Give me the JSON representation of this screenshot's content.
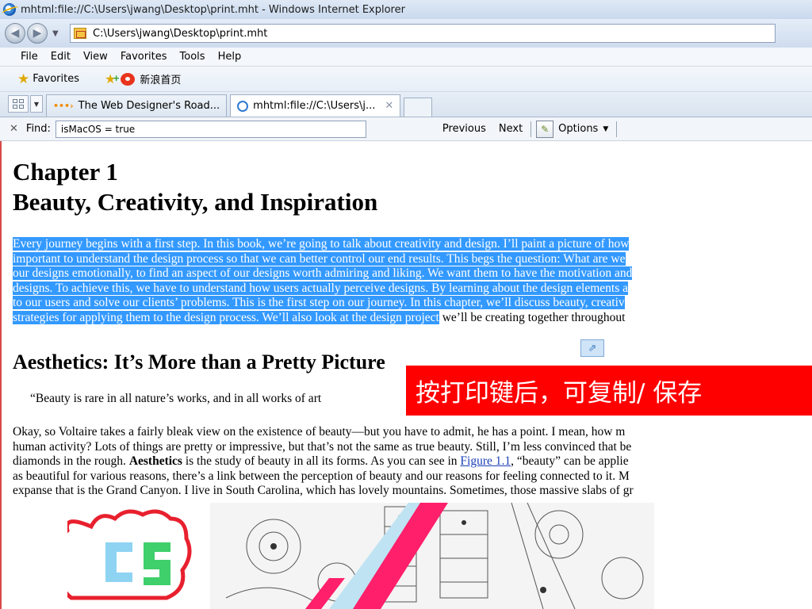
{
  "window": {
    "title": "mhtml:file://C:\\Users\\jwang\\Desktop\\print.mht - Windows Internet Explorer"
  },
  "address_bar": {
    "value": "C:\\Users\\jwang\\Desktop\\print.mht"
  },
  "menu": [
    "File",
    "Edit",
    "View",
    "Favorites",
    "Tools",
    "Help"
  ],
  "favorites_bar": {
    "favorites_label": "Favorites",
    "link_label": "新浪首页"
  },
  "tabs": [
    {
      "label": "The Web Designer's Road...",
      "icon": "rss-icon",
      "active": false
    },
    {
      "label": "mhtml:file://C:\\Users\\j...",
      "icon": "ie-icon",
      "active": true
    }
  ],
  "find_bar": {
    "label": "Find:",
    "value": "isMacOS = true",
    "previous": "Previous",
    "next": "Next",
    "options": "Options"
  },
  "content": {
    "chapter_line1": "Chapter 1",
    "chapter_line2": "Beauty, Creativity, and Inspiration",
    "intro_lines": [
      "Every journey begins with a first step. In this book, we’re going to talk about creativity and design. I’ll paint a picture of how",
      "important to understand the design process so that we can better control our end results. This begs the question: What are we",
      "our designs emotionally, to find an aspect of our designs worth admiring and liking. We want them to have the motivation and",
      "designs. To achieve this, we have to understand how users actually perceive designs. By learning about the design elements a",
      "to our users and solve our clients’ problems. This is the first step on our journey. In this chapter, we’ll discuss beauty, creativ",
      "strategies for applying them to the design process. We’ll also look at the design project"
    ],
    "intro_tail": " we’ll be creating together throughout",
    "section_title": "Aesthetics: It’s More than a Pretty Picture",
    "quote": "“Beauty is rare in all nature’s works, and in all works of art",
    "body_line1": "Okay, so Voltaire takes a fairly bleak view on the existence of beauty—but you have to admit, he has a point. I mean, how m",
    "body_line2": "human activity? Lots of things are pretty or impressive, but that’s not the same as true beauty. Still, I’m less convinced that be",
    "body_line3a": "diamonds in the rough. ",
    "body_line3_bold": "Aesthetics",
    "body_line3b": " is the study of beauty in all its forms. As you can see in ",
    "body_line3_link": "Figure 1.1",
    "body_line3c": ", “beauty” can be applie",
    "body_line4": "as beautiful for various reasons, there’s a link between the perception of beauty and our reasons for feeling connected to it. M",
    "body_line5": "expanse that is the Grand Canyon. I live in South Carolina, which has lovely mountains. Sometimes, those massive slabs of gr"
  },
  "overlay": {
    "text": "按打印键后，可复制/ 保存"
  },
  "colors": {
    "selection": "#3399ff",
    "overlay": "#ff0000",
    "link": "#1a3fb8"
  }
}
